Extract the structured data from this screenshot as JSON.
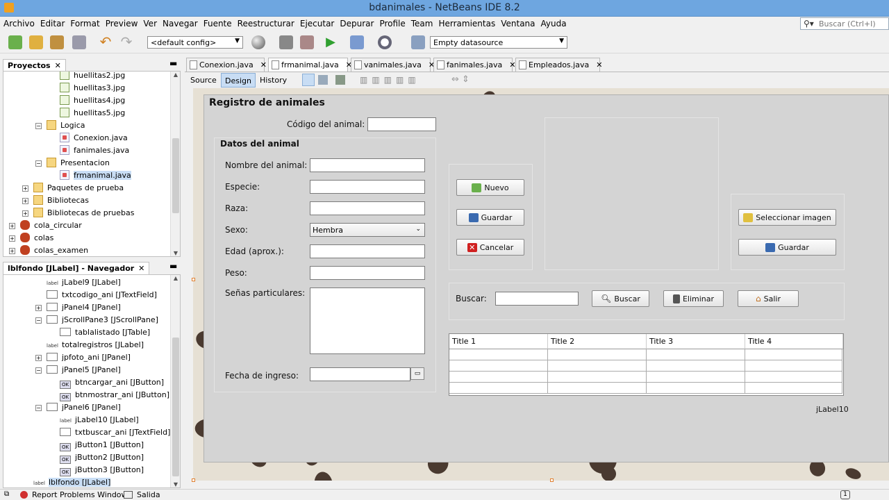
{
  "window": {
    "title": "bdanimales - NetBeans IDE 8.2"
  },
  "menu": [
    "Archivo",
    "Editar",
    "Format",
    "Preview",
    "Ver",
    "Navegar",
    "Fuente",
    "Reestructurar",
    "Ejecutar",
    "Depurar",
    "Profile",
    "Team",
    "Herramientas",
    "Ventana",
    "Ayuda"
  ],
  "search": {
    "placeholder": "Buscar (Ctrl+I)"
  },
  "toolbar": {
    "config": "<default config>",
    "datasource": "Empty datasource"
  },
  "projects": {
    "title": "Proyectos",
    "items": [
      {
        "label": "huellitas2.jpg",
        "indent": 3,
        "icon": "image"
      },
      {
        "label": "huellitas3.jpg",
        "indent": 3,
        "icon": "image"
      },
      {
        "label": "huellitas4.jpg",
        "indent": 3,
        "icon": "image"
      },
      {
        "label": "huellitas5.jpg",
        "indent": 3,
        "icon": "image"
      },
      {
        "label": "Logica",
        "indent": 2,
        "icon": "package",
        "toggle": "−"
      },
      {
        "label": "Conexion.java",
        "indent": 3,
        "icon": "java"
      },
      {
        "label": "fanimales.java",
        "indent": 3,
        "icon": "java"
      },
      {
        "label": "Presentacion",
        "indent": 2,
        "icon": "package",
        "toggle": "−"
      },
      {
        "label": "frmanimal.java",
        "indent": 3,
        "icon": "java",
        "selected": true
      },
      {
        "label": "Paquetes de prueba",
        "indent": 1,
        "icon": "folder",
        "toggle": "+"
      },
      {
        "label": "Bibliotecas",
        "indent": 1,
        "icon": "folder",
        "toggle": "+"
      },
      {
        "label": "Bibliotecas de pruebas",
        "indent": 1,
        "icon": "folder",
        "toggle": "+"
      },
      {
        "label": "cola_circular",
        "indent": 0,
        "icon": "project",
        "toggle": "+"
      },
      {
        "label": "colas",
        "indent": 0,
        "icon": "project",
        "toggle": "+"
      },
      {
        "label": "colas_examen",
        "indent": 0,
        "icon": "project",
        "toggle": "+"
      }
    ]
  },
  "navigator": {
    "title": "lblfondo [JLabel] - Navegador",
    "items": [
      {
        "label": "jLabel9 [JLabel]",
        "indent": 2,
        "icon": "label"
      },
      {
        "label": "txtcodigo_ani [JTextField]",
        "indent": 2,
        "icon": "field"
      },
      {
        "label": "jPanel4 [JPanel]",
        "indent": 2,
        "icon": "panel",
        "toggle": "+"
      },
      {
        "label": "jScrollPane3 [JScrollPane]",
        "indent": 2,
        "icon": "panel",
        "toggle": "−"
      },
      {
        "label": "tablalistado [JTable]",
        "indent": 3,
        "icon": "table"
      },
      {
        "label": "totalregistros [JLabel]",
        "indent": 2,
        "icon": "label"
      },
      {
        "label": "jpfoto_ani [JPanel]",
        "indent": 2,
        "icon": "panel",
        "toggle": "+"
      },
      {
        "label": "jPanel5 [JPanel]",
        "indent": 2,
        "icon": "panel",
        "toggle": "−"
      },
      {
        "label": "btncargar_ani [JButton]",
        "indent": 3,
        "icon": "button"
      },
      {
        "label": "btnmostrar_ani [JButton]",
        "indent": 3,
        "icon": "button"
      },
      {
        "label": "jPanel6 [JPanel]",
        "indent": 2,
        "icon": "panel",
        "toggle": "−"
      },
      {
        "label": "jLabel10 [JLabel]",
        "indent": 3,
        "icon": "label"
      },
      {
        "label": "txtbuscar_ani [JTextField]",
        "indent": 3,
        "icon": "field"
      },
      {
        "label": "jButton1 [JButton]",
        "indent": 3,
        "icon": "button"
      },
      {
        "label": "jButton2 [JButton]",
        "indent": 3,
        "icon": "button"
      },
      {
        "label": "jButton3 [JButton]",
        "indent": 3,
        "icon": "button"
      },
      {
        "label": "lblfondo [JLabel]",
        "indent": 1,
        "icon": "label",
        "selected": true
      }
    ]
  },
  "editor_tabs": [
    "Conexion.java",
    "frmanimal.java",
    "vanimales.java",
    "fanimales.java",
    "Empleados.java"
  ],
  "view_tabs": [
    "Source",
    "Design",
    "History"
  ],
  "form": {
    "title": "Registro de animales",
    "codigo_label": "Código del animal:",
    "datos_title": "Datos del animal",
    "nombre_label": "Nombre del animal:",
    "especie_label": "Especie:",
    "raza_label": "Raza:",
    "sexo_label": "Sexo:",
    "sexo_value": "Hembra",
    "edad_label": "Edad (aprox.):",
    "peso_label": "Peso:",
    "senas_label": "Señas particulares:",
    "fecha_label": "Fecha de ingreso:",
    "btn_nuevo": "Nuevo",
    "btn_guardar": "Guardar",
    "btn_cancelar": "Cancelar",
    "btn_seleccionar": "Seleccionar imagen",
    "btn_guardar2": "Guardar",
    "buscar_label": "Buscar:",
    "btn_buscar": "Buscar",
    "btn_eliminar": "Eliminar",
    "btn_salir": "Salir",
    "table_headers": [
      "Title 1",
      "Title 2",
      "Title 3",
      "Title 4"
    ],
    "jlabel10": "jLabel10"
  },
  "status": {
    "problems": "Report Problems Window",
    "output": "Salida",
    "badge": "1"
  }
}
